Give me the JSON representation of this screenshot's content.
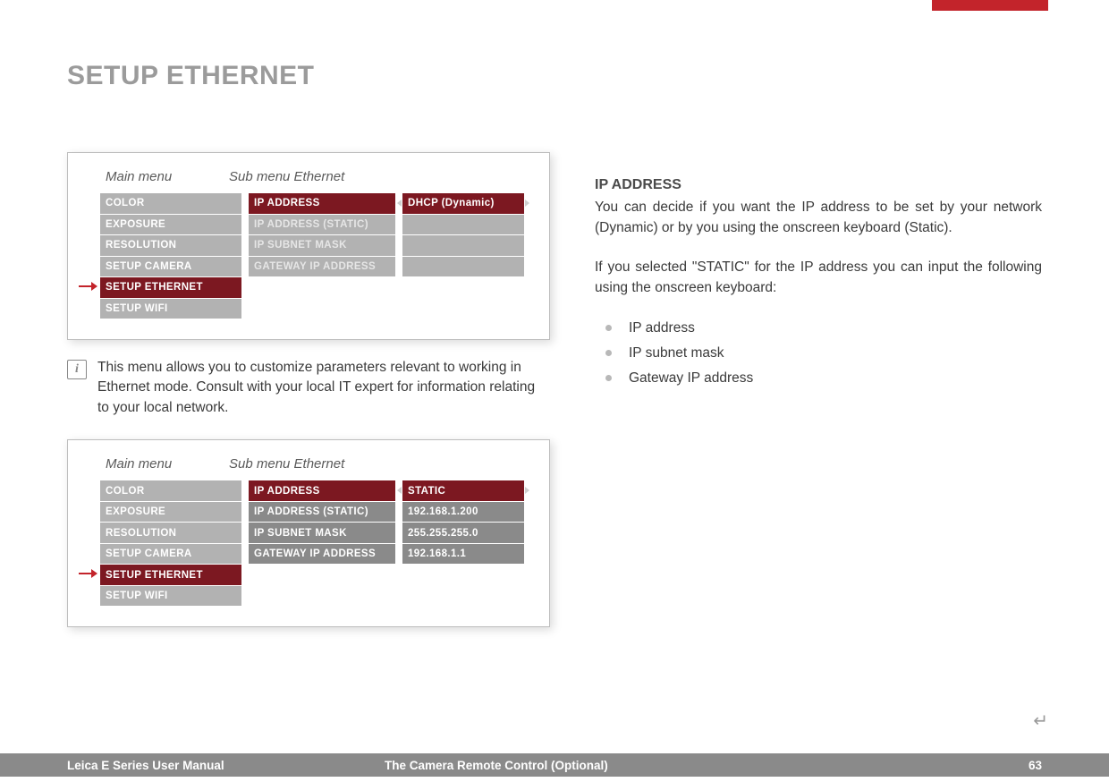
{
  "header": {
    "title": "SETUP ETHERNET"
  },
  "panel_labels": {
    "main": "Main menu",
    "sub": "Sub menu Ethernet"
  },
  "main_menu": {
    "items": [
      "COLOR",
      "EXPOSURE",
      "RESOLUTION",
      "SETUP CAMERA",
      "SETUP ETHERNET",
      "SETUP WIFI"
    ],
    "selected_index": 4
  },
  "panel_dynamic": {
    "sub_items": [
      {
        "label": "IP ADDRESS",
        "enabled": true,
        "value": "DHCP (Dynamic)",
        "value_style": "sel"
      },
      {
        "label": "IP ADDRESS (STATIC)",
        "enabled": false,
        "value": "",
        "value_style": "empty"
      },
      {
        "label": "IP SUBNET MASK",
        "enabled": false,
        "value": "",
        "value_style": "empty"
      },
      {
        "label": "GATEWAY IP ADDRESS",
        "enabled": false,
        "value": "",
        "value_style": "empty"
      }
    ]
  },
  "panel_static": {
    "sub_items": [
      {
        "label": "IP ADDRESS",
        "enabled": true,
        "value": "STATIC",
        "value_style": "sel"
      },
      {
        "label": "IP ADDRESS (STATIC)",
        "enabled": true,
        "value": "192.168.1.200",
        "value_style": "dgrey"
      },
      {
        "label": "IP SUBNET MASK",
        "enabled": true,
        "value": "255.255.255.0",
        "value_style": "dgrey"
      },
      {
        "label": "GATEWAY IP ADDRESS",
        "enabled": true,
        "value": "192.168.1.1",
        "value_style": "dgrey"
      }
    ]
  },
  "info_text": "This menu allows you to customize parameters relevant to working in Ethernet mode. Consult with your local IT expert for information relating to your local network.",
  "right": {
    "heading": "IP ADDRESS",
    "para1": "You can decide if you want the IP address to be set by your network (Dynamic) or by you using the onscreen keyboard (Static).",
    "para2": "If you selected \"STATIC\" for the IP address you can input the following using the onscreen keyboard:",
    "bullets": [
      "IP address",
      "IP subnet mask",
      "Gateway IP address"
    ]
  },
  "footer": {
    "left": "Leica E Series User Manual",
    "center": "The Camera Remote Control (Optional)",
    "page": "63"
  }
}
